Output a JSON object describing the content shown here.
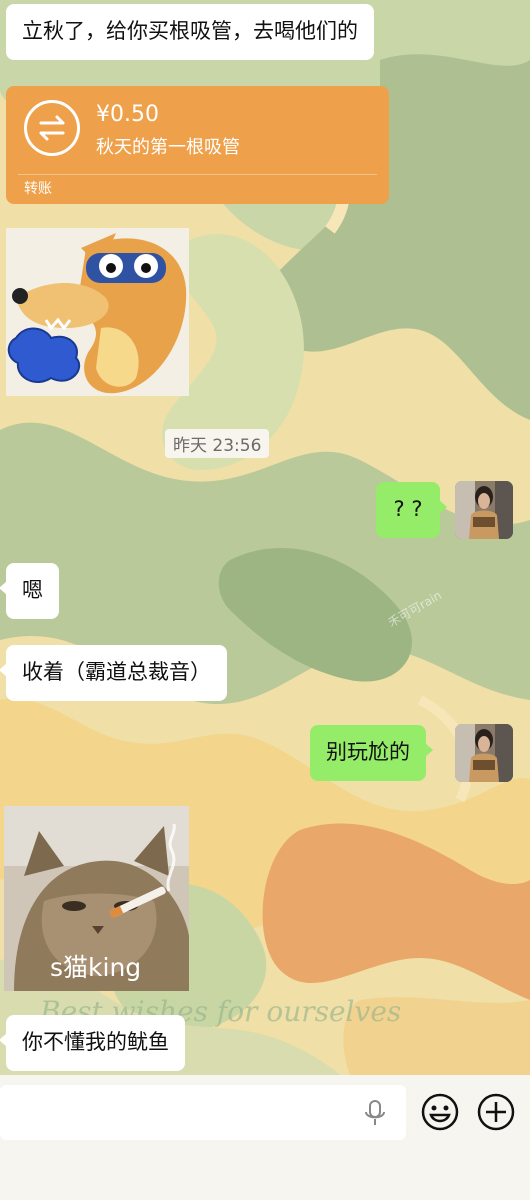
{
  "messages": {
    "m1": "立秋了，给你买根吸管，去喝他们的",
    "transfer": {
      "amount": "¥0.50",
      "note": "秋天的第一根吸管",
      "label": "转账"
    },
    "timestamp": "昨天 23:56",
    "m_qq": "? ?",
    "m_en": "嗯",
    "m_shou": "收着（霸道总裁音）",
    "m_bie": "别玩尬的",
    "cat_caption": "s猫king",
    "m_last": "你不懂我的鱿鱼"
  },
  "background": {
    "watermark": "禾可可rain",
    "quote": "Best wishes for ourselves"
  },
  "colors": {
    "bubble_right": "#95ec69",
    "bubble_left": "#ffffff",
    "transfer": "#eea14a"
  },
  "icons": {
    "voice": "mic-icon",
    "emoji": "smiley-icon",
    "more": "plus-circle-icon",
    "transfer": "transfer-arrows-icon"
  }
}
